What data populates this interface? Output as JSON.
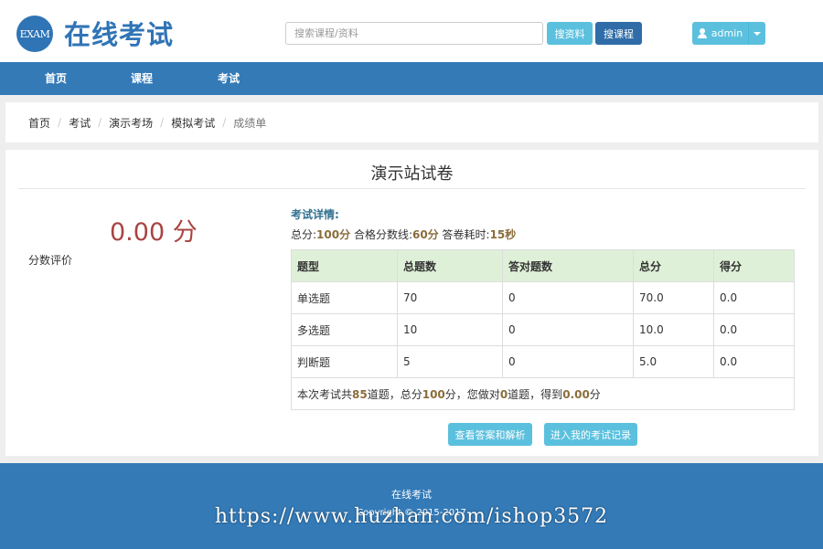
{
  "header": {
    "logo_mark": "EXAM",
    "site_title": "在线考试",
    "search_placeholder": "搜索课程/资料",
    "search_resources_label": "搜资料",
    "search_courses_label": "搜课程",
    "user_name": "admin"
  },
  "nav": {
    "items": [
      {
        "label": "首页"
      },
      {
        "label": "课程"
      },
      {
        "label": "考试"
      }
    ]
  },
  "breadcrumb": [
    "首页",
    "考试",
    "演示考场",
    "模拟考试",
    "成绩单"
  ],
  "result": {
    "paper_title": "演示站试卷",
    "score": "0.00 分",
    "score_label": "分数评价",
    "detail_title": "考试详情:",
    "total_label": "总分:",
    "total_value": "100分",
    "pass_label": "合格分数线:",
    "pass_value": "60分",
    "time_label": "答卷耗时:",
    "time_value": "15秒"
  },
  "table": {
    "headers": [
      "题型",
      "总题数",
      "答对题数",
      "总分",
      "得分"
    ],
    "rows": [
      [
        "单选题",
        "70",
        "0",
        "70.0",
        "0.0"
      ],
      [
        "多选题",
        "10",
        "0",
        "10.0",
        "0.0"
      ],
      [
        "判断题",
        "5",
        "0",
        "5.0",
        "0.0"
      ]
    ],
    "summary": {
      "p1": "本次考试共",
      "count": "85",
      "p2": "道题，总分",
      "total": "100",
      "p3": "分，您做对",
      "correct": "0",
      "p4": "道题，得到",
      "got": "0.00",
      "p5": "分"
    }
  },
  "actions": {
    "view_answers": "查看答案和解析",
    "my_records": "进入我的考试记录"
  },
  "footer": {
    "name": "在线考试",
    "copyright": "Copyright © 2015-2017",
    "watermark": "https://www.huzhan.com/ishop3572"
  },
  "colors": {
    "brand": "#337ab7",
    "info": "#5bc0de",
    "table_header": "#dff0d8",
    "score": "#a94442"
  }
}
